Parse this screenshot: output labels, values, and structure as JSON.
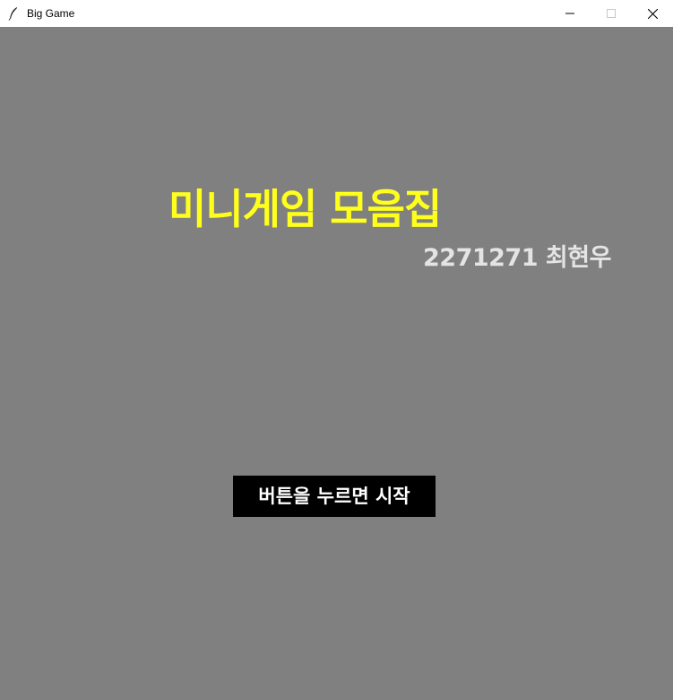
{
  "window": {
    "title": "Big Game",
    "controls": {
      "minimize_icon": "minimize-icon",
      "maximize_icon": "maximize-icon",
      "close_icon": "close-icon"
    }
  },
  "main": {
    "title": "미니게임 모음집",
    "author": "2271271 최현우",
    "start_button_label": "버튼을 누르면 시작"
  },
  "colors": {
    "background": "#808080",
    "title": "#ffff1e",
    "author": "#e4e4e4",
    "button_bg": "#000000",
    "button_text": "#ffffff"
  }
}
